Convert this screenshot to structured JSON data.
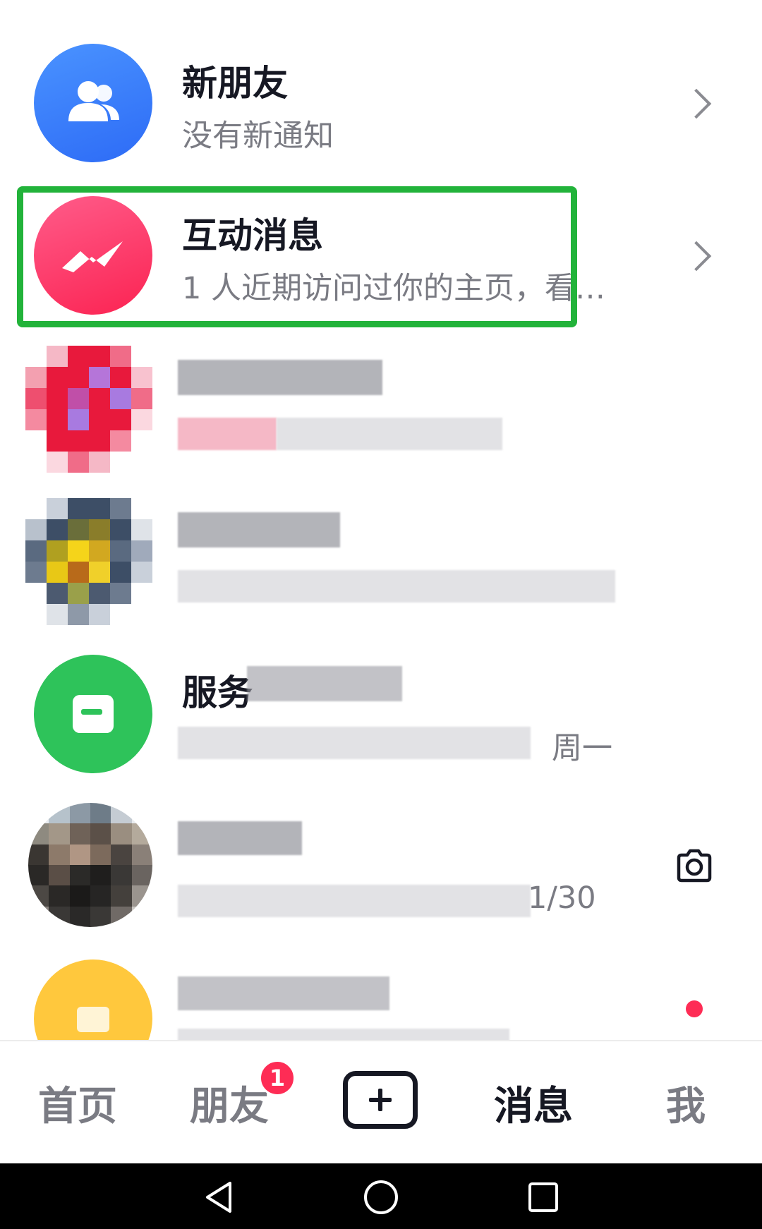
{
  "rows": [
    {
      "title": "新朋友",
      "subtitle": "没有新通知",
      "icon": "users-icon",
      "color": "#3a7dff"
    },
    {
      "title": "互动消息",
      "subtitle": "1 人近期访问过你的主页，看…",
      "icon": "activity-icon",
      "color": "#fe2c6f"
    },
    {
      "title": "",
      "subtitle": ""
    },
    {
      "title": "",
      "subtitle": ""
    },
    {
      "title": "服务",
      "subtitle": "周一"
    },
    {
      "title": "",
      "subtitle": "1/30",
      "action_icon": "camera-icon"
    },
    {
      "title": "",
      "subtitle": "",
      "unread_dot_color": "#fe2c55"
    }
  ],
  "tabbar": {
    "home": "首页",
    "friends": "朋友",
    "friends_badge": "1",
    "messages": "消息",
    "me": "我",
    "active": "消息"
  },
  "colors": {
    "highlight": "#22b33a",
    "badge": "#fe2c55"
  }
}
